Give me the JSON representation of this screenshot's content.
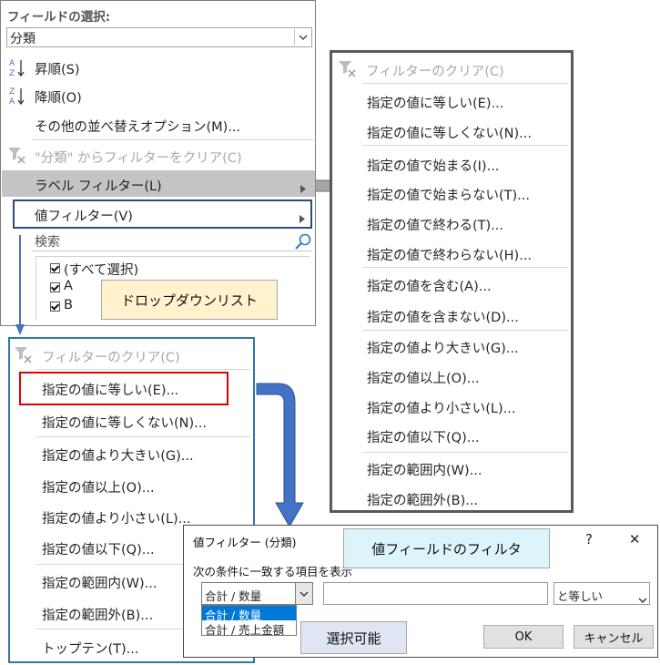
{
  "sort_menu": {
    "field_select_label": "フィールドの選択:",
    "field_value": "分類",
    "sort_asc": "昇順(S)",
    "sort_desc": "降順(O)",
    "more_sort": "その他の並べ替えオプション(M)...",
    "clear_filter": "\"分類\" からフィルターをクリア(C)",
    "label_filter": "ラベル フィルター(L)",
    "value_filter": "値フィルター(V)",
    "search_placeholder": "検索",
    "items": [
      "(すべて選択)",
      "A",
      "B"
    ],
    "callout": "ドロップダウンリスト"
  },
  "label_submenu": {
    "clear": "フィルターのクリア(C)",
    "items": [
      "指定の値に等しい(E)...",
      "指定の値に等しくない(N)...",
      "指定の値で始まる(I)...",
      "指定の値で始まらない(T)...",
      "指定の値で終わる(T)...",
      "指定の値で終わらない(H)...",
      "指定の値を含む(A)...",
      "指定の値を含まない(D)...",
      "指定の値より大きい(G)...",
      "指定の値以上(O)...",
      "指定の値より小さい(L)...",
      "指定の値以下(Q)...",
      "指定の範囲内(W)...",
      "指定の範囲外(B)..."
    ]
  },
  "value_submenu": {
    "clear": "フィルターのクリア(C)",
    "items": [
      "指定の値に等しい(E)...",
      "指定の値に等しくない(N)...",
      "指定の値より大きい(G)...",
      "指定の値以上(O)...",
      "指定の値より小さい(L)...",
      "指定の値以下(Q)...",
      "指定の範囲内(W)...",
      "指定の範囲外(B)...",
      "トップテン(T)..."
    ]
  },
  "dialog": {
    "title": "値フィルター (分類)",
    "help": "?",
    "close": "✕",
    "callout": "値フィールドのフィルタ",
    "instruction": "次の条件に一致する項目を表示",
    "field_value": "合計 / 数量",
    "options": [
      "合計 / 数量",
      "合計 / 売上金額"
    ],
    "operator_value": "と等しい",
    "callout2": "選択可能",
    "ok": "OK",
    "cancel": "キャンセル"
  },
  "colors": {
    "accent_blue": "#4472c4",
    "highlight_red": "#e00000",
    "callout_yellow": "#fff2cc",
    "callout_cyan": "#ddf4fb",
    "callout_gray": "#dfe5f2",
    "hover_gray": "#c4c4c4"
  }
}
